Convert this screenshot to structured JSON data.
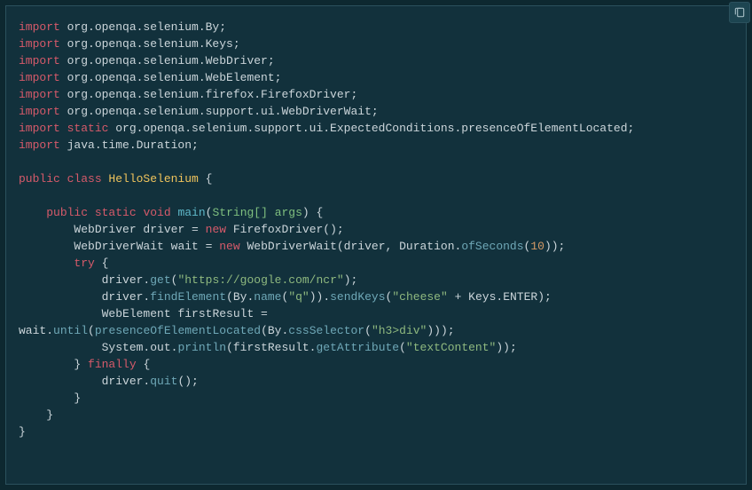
{
  "copy_button_label": "Copy",
  "code": {
    "lines": [
      {
        "indent": 0,
        "tokens": [
          {
            "t": "import ",
            "c": "kw"
          },
          {
            "t": "org.openqa.selenium.By;",
            "c": "default"
          }
        ]
      },
      {
        "indent": 0,
        "tokens": [
          {
            "t": "import ",
            "c": "kw"
          },
          {
            "t": "org.openqa.selenium.Keys;",
            "c": "default"
          }
        ]
      },
      {
        "indent": 0,
        "tokens": [
          {
            "t": "import ",
            "c": "kw"
          },
          {
            "t": "org.openqa.selenium.WebDriver;",
            "c": "default"
          }
        ]
      },
      {
        "indent": 0,
        "tokens": [
          {
            "t": "import ",
            "c": "kw"
          },
          {
            "t": "org.openqa.selenium.WebElement;",
            "c": "default"
          }
        ]
      },
      {
        "indent": 0,
        "tokens": [
          {
            "t": "import ",
            "c": "kw"
          },
          {
            "t": "org.openqa.selenium.firefox.FirefoxDriver;",
            "c": "default"
          }
        ]
      },
      {
        "indent": 0,
        "tokens": [
          {
            "t": "import ",
            "c": "kw"
          },
          {
            "t": "org.openqa.selenium.support.ui.WebDriverWait;",
            "c": "default"
          }
        ]
      },
      {
        "indent": 0,
        "tokens": [
          {
            "t": "import ",
            "c": "kw"
          },
          {
            "t": "static ",
            "c": "kw"
          },
          {
            "t": "org.openqa.selenium.support.ui.ExpectedConditions.presenceOfElementLocated;",
            "c": "default"
          }
        ]
      },
      {
        "indent": 0,
        "tokens": [
          {
            "t": "import ",
            "c": "kw"
          },
          {
            "t": "java.time.Duration;",
            "c": "default"
          }
        ]
      },
      {
        "indent": 0,
        "tokens": [
          {
            "t": "",
            "c": "default"
          }
        ]
      },
      {
        "indent": 0,
        "tokens": [
          {
            "t": "public ",
            "c": "kw"
          },
          {
            "t": "class ",
            "c": "kw"
          },
          {
            "t": "HelloSelenium",
            "c": "classnm"
          },
          {
            "t": " {",
            "c": "default"
          }
        ]
      },
      {
        "indent": 0,
        "tokens": [
          {
            "t": "",
            "c": "default"
          }
        ]
      },
      {
        "indent": 1,
        "tokens": [
          {
            "t": "public ",
            "c": "kw"
          },
          {
            "t": "static ",
            "c": "kw"
          },
          {
            "t": "void ",
            "c": "kw"
          },
          {
            "t": "main",
            "c": "method"
          },
          {
            "t": "(",
            "c": "default"
          },
          {
            "t": "String[] args",
            "c": "type"
          },
          {
            "t": ") {",
            "c": "default"
          }
        ]
      },
      {
        "indent": 2,
        "tokens": [
          {
            "t": "WebDriver driver = ",
            "c": "default"
          },
          {
            "t": "new ",
            "c": "kw"
          },
          {
            "t": "FirefoxDriver();",
            "c": "default"
          }
        ]
      },
      {
        "indent": 2,
        "tokens": [
          {
            "t": "WebDriverWait wait = ",
            "c": "default"
          },
          {
            "t": "new ",
            "c": "kw"
          },
          {
            "t": "WebDriverWait(driver, Duration.",
            "c": "default"
          },
          {
            "t": "ofSeconds",
            "c": "call"
          },
          {
            "t": "(",
            "c": "default"
          },
          {
            "t": "10",
            "c": "num"
          },
          {
            "t": "));",
            "c": "default"
          }
        ]
      },
      {
        "indent": 2,
        "tokens": [
          {
            "t": "try ",
            "c": "kw"
          },
          {
            "t": "{",
            "c": "default"
          }
        ]
      },
      {
        "indent": 3,
        "tokens": [
          {
            "t": "driver.",
            "c": "default"
          },
          {
            "t": "get",
            "c": "call"
          },
          {
            "t": "(",
            "c": "default"
          },
          {
            "t": "\"https://google.com/ncr\"",
            "c": "str"
          },
          {
            "t": ");",
            "c": "default"
          }
        ]
      },
      {
        "indent": 3,
        "tokens": [
          {
            "t": "driver.",
            "c": "default"
          },
          {
            "t": "findElement",
            "c": "call"
          },
          {
            "t": "(By.",
            "c": "default"
          },
          {
            "t": "name",
            "c": "call"
          },
          {
            "t": "(",
            "c": "default"
          },
          {
            "t": "\"q\"",
            "c": "str"
          },
          {
            "t": ")).",
            "c": "default"
          },
          {
            "t": "sendKeys",
            "c": "call"
          },
          {
            "t": "(",
            "c": "default"
          },
          {
            "t": "\"cheese\"",
            "c": "str"
          },
          {
            "t": " + Keys.ENTER);",
            "c": "default"
          }
        ]
      },
      {
        "indent": 3,
        "tokens": [
          {
            "t": "WebElement firstResult = ",
            "c": "default"
          }
        ]
      },
      {
        "indent": 0,
        "tokens": [
          {
            "t": "wait.",
            "c": "default"
          },
          {
            "t": "until",
            "c": "call"
          },
          {
            "t": "(",
            "c": "default"
          },
          {
            "t": "presenceOfElementLocated",
            "c": "call"
          },
          {
            "t": "(By.",
            "c": "default"
          },
          {
            "t": "cssSelector",
            "c": "call"
          },
          {
            "t": "(",
            "c": "default"
          },
          {
            "t": "\"h3>div\"",
            "c": "str"
          },
          {
            "t": ")));",
            "c": "default"
          }
        ]
      },
      {
        "indent": 3,
        "tokens": [
          {
            "t": "System.out.",
            "c": "default"
          },
          {
            "t": "println",
            "c": "call"
          },
          {
            "t": "(firstResult.",
            "c": "default"
          },
          {
            "t": "getAttribute",
            "c": "call"
          },
          {
            "t": "(",
            "c": "default"
          },
          {
            "t": "\"textContent\"",
            "c": "str"
          },
          {
            "t": "));",
            "c": "default"
          }
        ]
      },
      {
        "indent": 2,
        "tokens": [
          {
            "t": "} ",
            "c": "default"
          },
          {
            "t": "finally ",
            "c": "kw"
          },
          {
            "t": "{",
            "c": "default"
          }
        ]
      },
      {
        "indent": 3,
        "tokens": [
          {
            "t": "driver.",
            "c": "default"
          },
          {
            "t": "quit",
            "c": "call"
          },
          {
            "t": "();",
            "c": "default"
          }
        ]
      },
      {
        "indent": 2,
        "tokens": [
          {
            "t": "}",
            "c": "default"
          }
        ]
      },
      {
        "indent": 1,
        "tokens": [
          {
            "t": "}",
            "c": "default"
          }
        ]
      },
      {
        "indent": 0,
        "tokens": [
          {
            "t": "}",
            "c": "default"
          }
        ]
      }
    ],
    "indent_unit": "    "
  }
}
